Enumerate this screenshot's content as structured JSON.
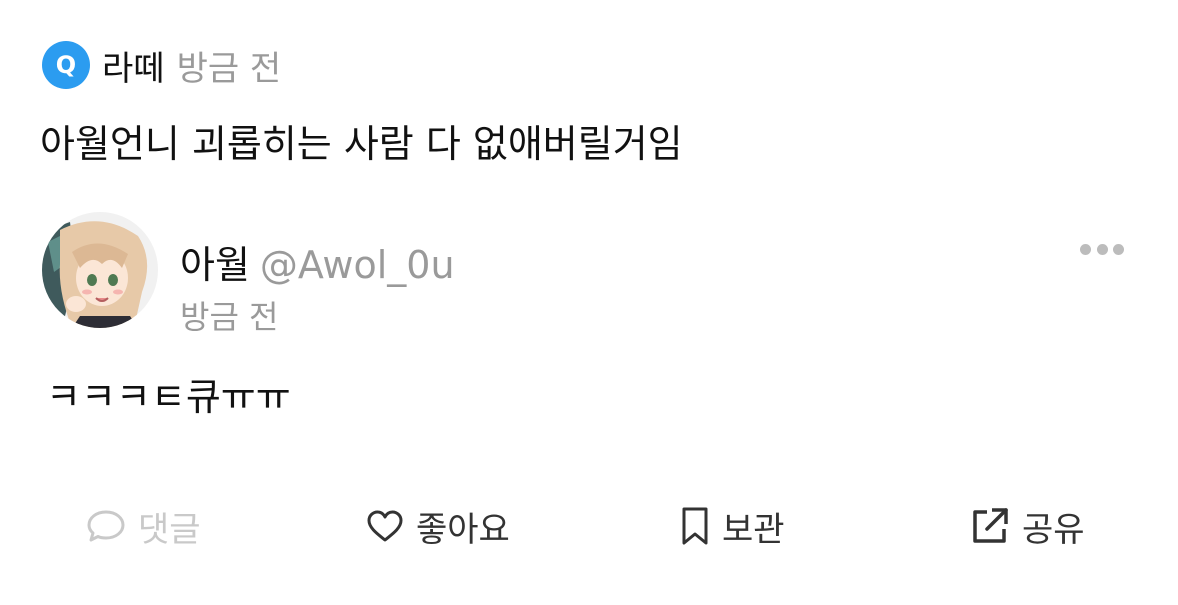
{
  "colors": {
    "badge_blue": "#2b9cf0",
    "muted_text": "#9a9a9a",
    "disabled_action": "#c9c9c9",
    "action_text": "#333333"
  },
  "question": {
    "badge_letter": "Q",
    "badge_icon": "q-badge-icon",
    "asker": "라떼",
    "time": "방금 전",
    "text": "아월언니 괴롭히는 사람 다 없애버릴거임"
  },
  "answer": {
    "name": "아월",
    "handle": "@Awol_0u",
    "time": "방금 전",
    "text": "ㅋㅋㅋㅌ큐ㅠㅠ",
    "more_icon": "more-icon"
  },
  "actions": {
    "comment": {
      "label": "댓글",
      "icon": "comment-icon"
    },
    "like": {
      "label": "좋아요",
      "icon": "heart-icon"
    },
    "save": {
      "label": "보관",
      "icon": "bookmark-icon"
    },
    "share": {
      "label": "공유",
      "icon": "share-icon"
    }
  }
}
